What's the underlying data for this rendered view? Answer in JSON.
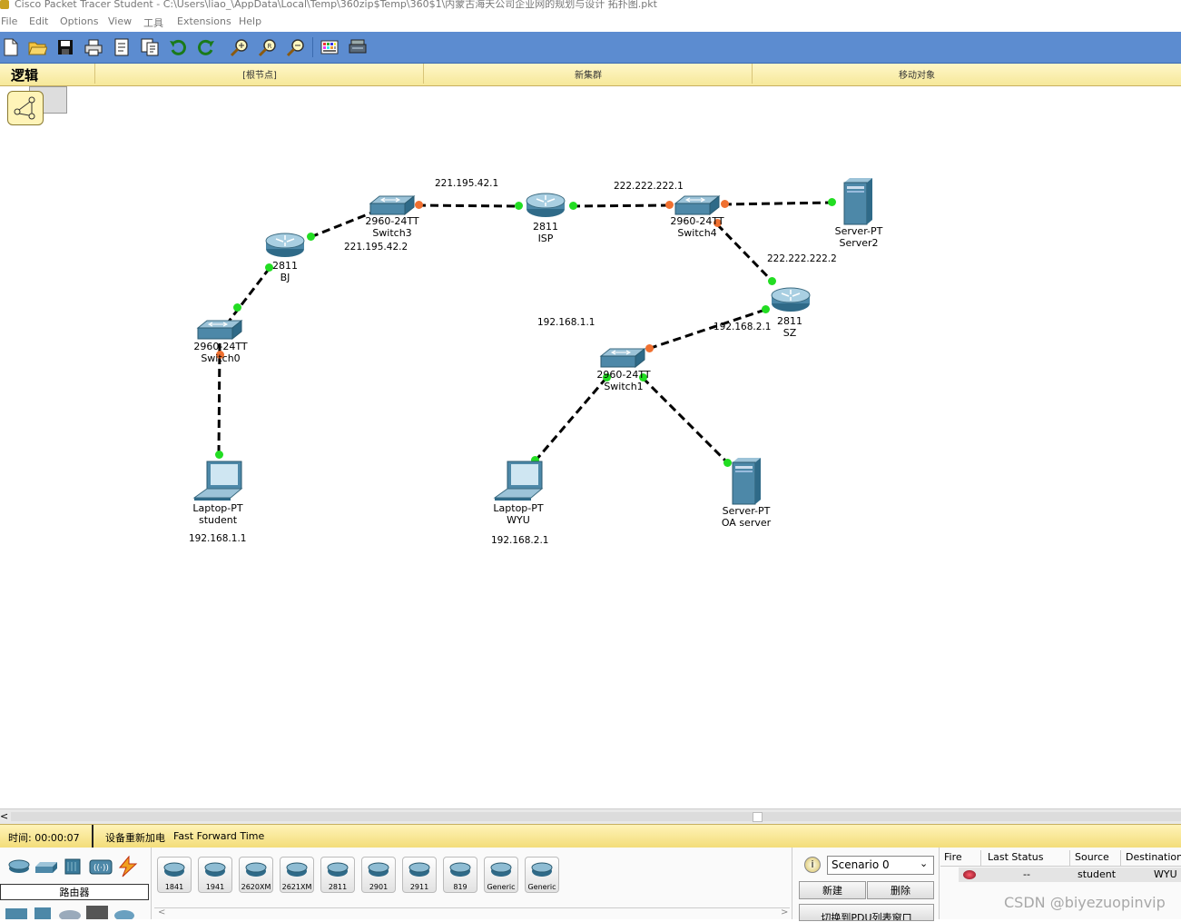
{
  "window": {
    "title": "Cisco Packet Tracer Student - C:\\Users\\liao_\\AppData\\Local\\Temp\\360zip$Temp\\360$1\\内蒙古海天公司企业网的规划与设计 拓扑图.pkt"
  },
  "menu": [
    "File",
    "Edit",
    "Options",
    "View",
    "工具",
    "Extensions",
    "Help"
  ],
  "toolbar_icons": [
    "new-file-icon",
    "open-folder-icon",
    "save-icon",
    "print-icon",
    "activity-wizard-icon",
    "copy-icon",
    "undo-icon",
    "redo-icon",
    "zoom-in-icon",
    "zoom-reset-icon",
    "zoom-out-icon",
    "palette-icon",
    "custom-device-icon"
  ],
  "logicbar": {
    "label": "逻辑",
    "root": "[根节点]",
    "new_cluster": "新集群",
    "move_object": "移动对象"
  },
  "devices": [
    {
      "id": "switch3",
      "model": "2960-24TT",
      "name": "Switch3",
      "type": "switch"
    },
    {
      "id": "isp",
      "model": "2811",
      "name": "ISP",
      "type": "router"
    },
    {
      "id": "switch4",
      "model": "2960-24TT",
      "name": "Switch4",
      "type": "switch"
    },
    {
      "id": "server2",
      "model": "Server-PT",
      "name": "Server2",
      "type": "server"
    },
    {
      "id": "bj",
      "model": "2811",
      "name": "BJ",
      "type": "router"
    },
    {
      "id": "sz",
      "model": "2811",
      "name": "SZ",
      "type": "router"
    },
    {
      "id": "switch0",
      "model": "2960-24TT",
      "name": "Switch0",
      "type": "switch"
    },
    {
      "id": "switch1",
      "model": "2960-24TT",
      "name": "Switch1",
      "type": "switch"
    },
    {
      "id": "student",
      "model": "Laptop-PT",
      "name": "student",
      "type": "laptop"
    },
    {
      "id": "wyu",
      "model": "Laptop-PT",
      "name": "WYU",
      "type": "laptop"
    },
    {
      "id": "oaserver",
      "model": "Server-PT",
      "name": "OA server",
      "type": "server"
    }
  ],
  "ip_labels": {
    "isp_left": "221.195.42.1",
    "bj_wan": "221.195.42.2",
    "isp_right": "222.222.222.1",
    "sz_wan": "222.222.222.2",
    "lan1_gw": "192.168.1.1",
    "lan2_gw": "192.168.2.1",
    "student_ip": "192.168.1.1",
    "wyu_ip": "192.168.2.1"
  },
  "colors": {
    "link_up": "#22dd22",
    "link_starting": "#f07030",
    "toolbar": "#5c8cd0",
    "bar_yellow": "#f6e89a"
  },
  "status": {
    "time_label": "时间: 00:00:07",
    "power_cycle": "设备重新加电",
    "fast_forward": "Fast Forward Time"
  },
  "device_panel": {
    "categories": [
      "router-category-icon",
      "switch-category-icon",
      "hub-category-icon",
      "wireless-category-icon",
      "connection-category-icon"
    ],
    "category_label": "路由器",
    "models": [
      "1841",
      "1941",
      "2620XM",
      "2621XM",
      "2811",
      "2901",
      "2911",
      "819",
      "Generic",
      "Generic"
    ]
  },
  "scenario": {
    "selected": "Scenario 0",
    "new_btn": "新建",
    "delete_btn": "删除",
    "pdu_btn": "切换到PDU列表窗口"
  },
  "pdu_table": {
    "headers": [
      "Fire",
      "Last Status",
      "Source",
      "Destination"
    ],
    "rows": [
      {
        "status": "--",
        "source": "student",
        "destination": "WYU"
      }
    ]
  },
  "watermark": "CSDN @biyezuopinvip"
}
